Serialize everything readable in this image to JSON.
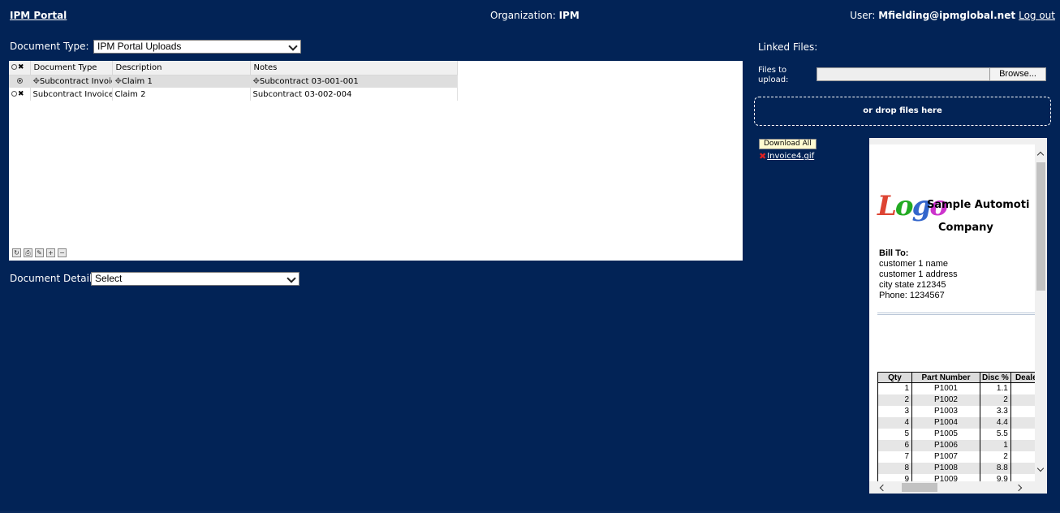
{
  "header": {
    "portal_label": "IPM Portal",
    "org_label": "Organization: ",
    "org_value": "IPM",
    "user_label": "User: ",
    "user_value": "Mfielding@ipmglobal.net",
    "logout_label": "Log out"
  },
  "document_type": {
    "label": "Document Type:",
    "value": "IPM Portal Uploads"
  },
  "grid": {
    "columns": [
      "Document Type",
      "Description",
      "Notes"
    ],
    "rows": [
      {
        "type": "Subcontract Invoice",
        "description": "Claim 1",
        "notes": "Subcontract 03-001-001",
        "selected": true
      },
      {
        "type": "Subcontract Invoice",
        "description": "Claim 2",
        "notes": "Subcontract 03-002-004",
        "selected": false
      }
    ]
  },
  "document_details": {
    "label": "Document Details:",
    "value": "Select"
  },
  "linked_files": {
    "title": "Linked Files:",
    "files_to_upload_label": "Files to upload:",
    "browse_label": "Browse...",
    "drop_label": "or drop files here",
    "download_all_label": "Download All",
    "file_name": "Invoice4.gif"
  },
  "preview": {
    "company_line1": "Sample Automoti",
    "company_line2": "Company",
    "bill_to_label": "Bill To:",
    "bill_lines": [
      "customer 1 name",
      "customer 1 address",
      "city state z12345",
      "Phone: 1234567"
    ],
    "table_headers": [
      "Qty",
      "Part Number",
      "Disc %",
      "Deale"
    ],
    "table_rows": [
      [
        "1",
        "P1001",
        "1.1"
      ],
      [
        "2",
        "P1002",
        "2"
      ],
      [
        "3",
        "P1003",
        "3.3"
      ],
      [
        "4",
        "P1004",
        "4.4"
      ],
      [
        "5",
        "P1005",
        "5.5"
      ],
      [
        "6",
        "P1006",
        "1"
      ],
      [
        "7",
        "P1007",
        "2"
      ],
      [
        "8",
        "P1008",
        "8.8"
      ],
      [
        "9",
        "P1009",
        "9.9"
      ]
    ]
  },
  "colors": {
    "background": "#022356",
    "panel": "#ffffff",
    "selected_row": "#dedede"
  }
}
